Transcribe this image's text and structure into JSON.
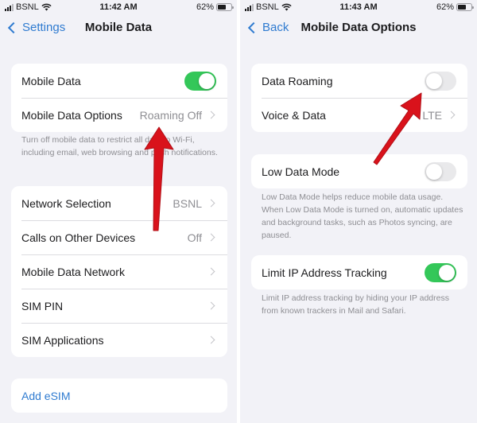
{
  "left": {
    "status": {
      "carrier": "BSNL",
      "time": "11:42 AM",
      "battery": "62%",
      "battery_level": 0.62
    },
    "nav": {
      "back_label": "Settings",
      "title": "Mobile Data"
    },
    "sections": [
      {
        "rows": [
          {
            "label": "Mobile Data",
            "toggle": true
          },
          {
            "label": "Mobile Data Options",
            "value": "Roaming Off"
          }
        ],
        "footnote": "Turn off mobile data to restrict all data to Wi-Fi, including email, web browsing and push notifications."
      },
      {
        "rows": [
          {
            "label": "Network Selection",
            "value": "BSNL"
          },
          {
            "label": "Calls on Other Devices",
            "value": "Off"
          },
          {
            "label": "Mobile Data Network",
            "value": ""
          },
          {
            "label": "SIM PIN",
            "value": ""
          },
          {
            "label": "SIM Applications",
            "value": ""
          }
        ]
      },
      {
        "rows": [
          {
            "label": "Add eSIM"
          }
        ]
      }
    ]
  },
  "right": {
    "status": {
      "carrier": "BSNL",
      "time": "11:43 AM",
      "battery": "62%",
      "battery_level": 0.62
    },
    "nav": {
      "back_label": "Back",
      "title": "Mobile Data Options"
    },
    "sections": [
      {
        "rows": [
          {
            "label": "Data Roaming",
            "toggle": false
          },
          {
            "label": "Voice & Data",
            "value": "LTE"
          }
        ]
      },
      {
        "rows": [
          {
            "label": "Low Data Mode",
            "toggle": false
          }
        ],
        "footnote": "Low Data Mode helps reduce mobile data usage. When Low Data Mode is turned on, automatic updates and background tasks, such as Photos syncing, are paused."
      },
      {
        "rows": [
          {
            "label": "Limit IP Address Tracking",
            "toggle": true
          }
        ],
        "footnote": "Limit IP address tracking by hiding your IP address from known trackers in Mail and Safari."
      }
    ]
  },
  "annotations": {
    "arrow_color": "#d9121b",
    "arrows": [
      "points to Roaming Off value",
      "points to Data Roaming toggle"
    ]
  },
  "colors": {
    "accent": "#2f7bd0",
    "toggle_on": "#34c759",
    "background": "#f2f2f7"
  }
}
